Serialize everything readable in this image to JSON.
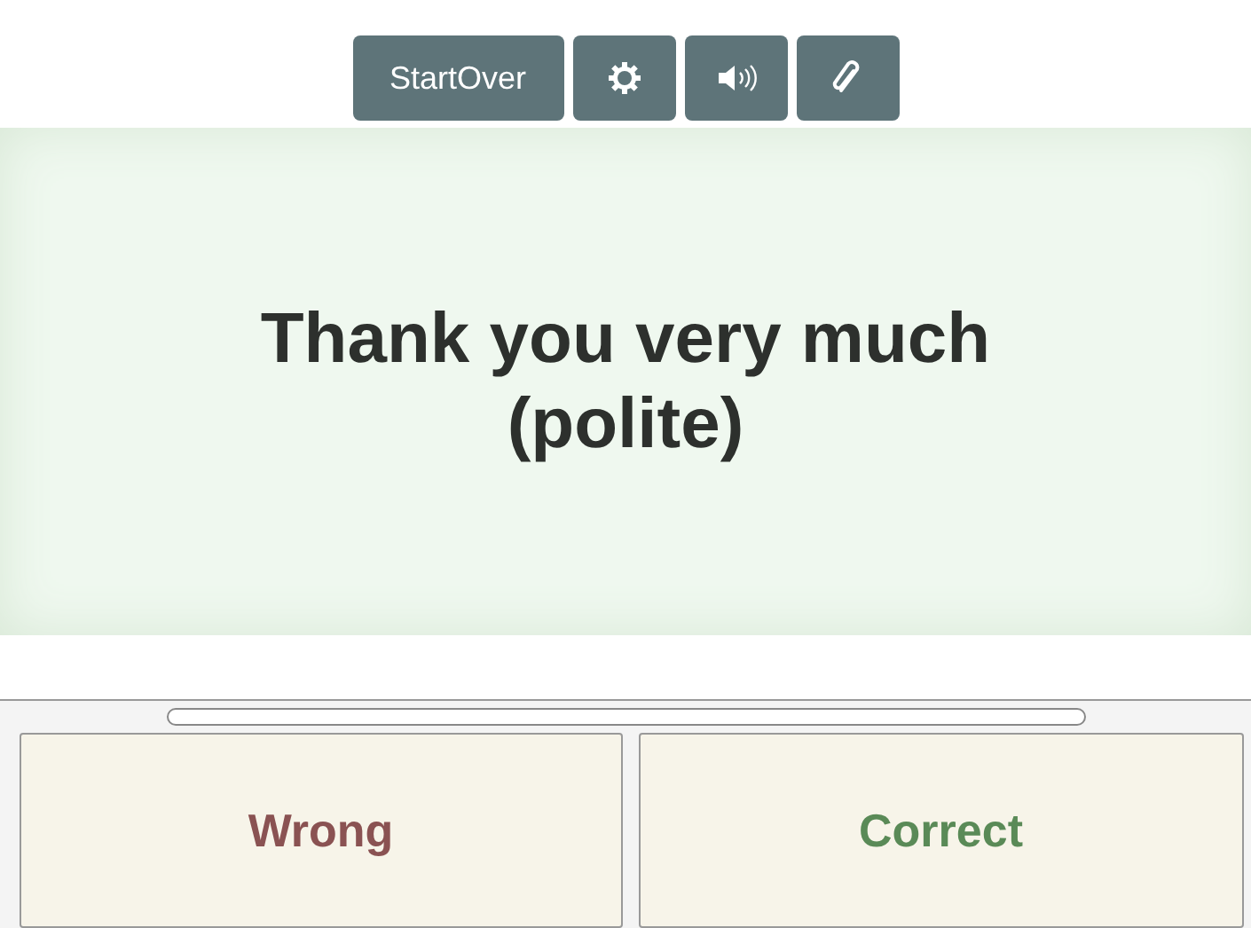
{
  "toolbar": {
    "start_over": "StartOver"
  },
  "card": {
    "text": "Thank you very much (polite)"
  },
  "answers": [
    {
      "label": "Wrong",
      "kind": "wrong"
    },
    {
      "label": "Correct",
      "kind": "correct"
    }
  ]
}
